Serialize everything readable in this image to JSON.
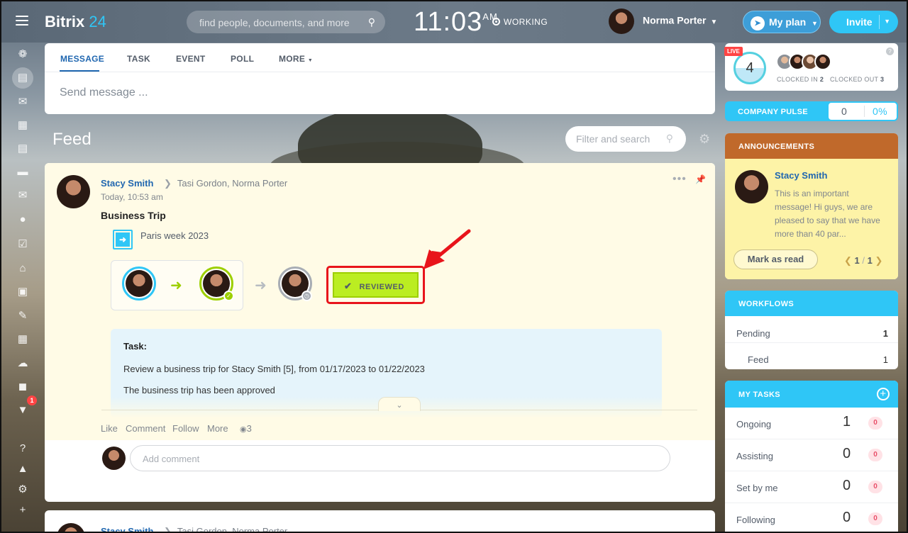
{
  "header": {
    "logo_main": "Bitrix",
    "logo_num": "24",
    "search_placeholder": "find people, documents, and more",
    "time": "11:03",
    "ampm": "AM",
    "status": "WORKING",
    "user_name": "Norma Porter",
    "myplan_label": "My plan",
    "invite_label": "Invite"
  },
  "rail": {
    "items": [
      "widgets-icon",
      "feed-icon",
      "chat-icon",
      "calendar-icon",
      "documents-icon",
      "drive-icon",
      "mail-icon",
      "groups-icon",
      "tasks-icon",
      "crm-icon",
      "sites-icon",
      "signing-icon",
      "contacts-icon",
      "bots-icon",
      "store-icon",
      "more-icon",
      "help-icon",
      "structure-icon",
      "settings-icon",
      "add-icon"
    ],
    "badge": "1"
  },
  "composer": {
    "tabs": [
      "MESSAGE",
      "TASK",
      "EVENT",
      "POLL",
      "MORE"
    ],
    "placeholder": "Send message ..."
  },
  "feed": {
    "title": "Feed",
    "filter_placeholder": "Filter and search"
  },
  "post": {
    "author": "Stacy Smith",
    "recipients": "Tasi Gordon, Norma Porter",
    "time": "Today, 10:53 am",
    "title": "Business Trip",
    "file_name": "Paris week 2023",
    "status_button": "REVIEWED",
    "task_label": "Task:",
    "task_line1": "Review a business trip for Stacy Smith [5], from 01/17/2023 to 01/22/2023",
    "task_line2": "The business trip has been approved",
    "actions": [
      "Like",
      "Comment",
      "Follow",
      "More"
    ],
    "views": "3",
    "comment_placeholder": "Add comment"
  },
  "post2": {
    "author": "Stacy Smith",
    "recipients": "Tasi Gordon, Norma Porter"
  },
  "timeman": {
    "live": "LIVE",
    "count": "4",
    "clocked_in_label": "CLOCKED IN",
    "clocked_in": "2",
    "clocked_out_label": "CLOCKED OUT",
    "clocked_out": "3"
  },
  "pulse": {
    "label": "COMPANY PULSE",
    "value": "0",
    "percent": "0%"
  },
  "announcements": {
    "title": "ANNOUNCEMENTS",
    "author": "Stacy Smith",
    "text": "This is an important message! Hi guys, we are pleased to say that we have more than 40 par...",
    "mark_read": "Mark as read",
    "page_current": "1",
    "page_total": "1"
  },
  "workflows": {
    "title": "WORKFLOWS",
    "rows": [
      {
        "label": "Pending",
        "count": "1"
      },
      {
        "label": "Feed",
        "count": "1"
      }
    ]
  },
  "tasks": {
    "title": "MY TASKS",
    "rows": [
      {
        "label": "Ongoing",
        "count": "1",
        "badge": "0"
      },
      {
        "label": "Assisting",
        "count": "0",
        "badge": "0"
      },
      {
        "label": "Set by me",
        "count": "0",
        "badge": "0"
      },
      {
        "label": "Following",
        "count": "0",
        "badge": "0"
      }
    ]
  },
  "colors": {
    "accent": "#2fc6f6",
    "link": "#2067b0",
    "reviewed_green": "#bbed21",
    "highlight_red": "#e8141b",
    "announcement_header": "#c0692b"
  }
}
